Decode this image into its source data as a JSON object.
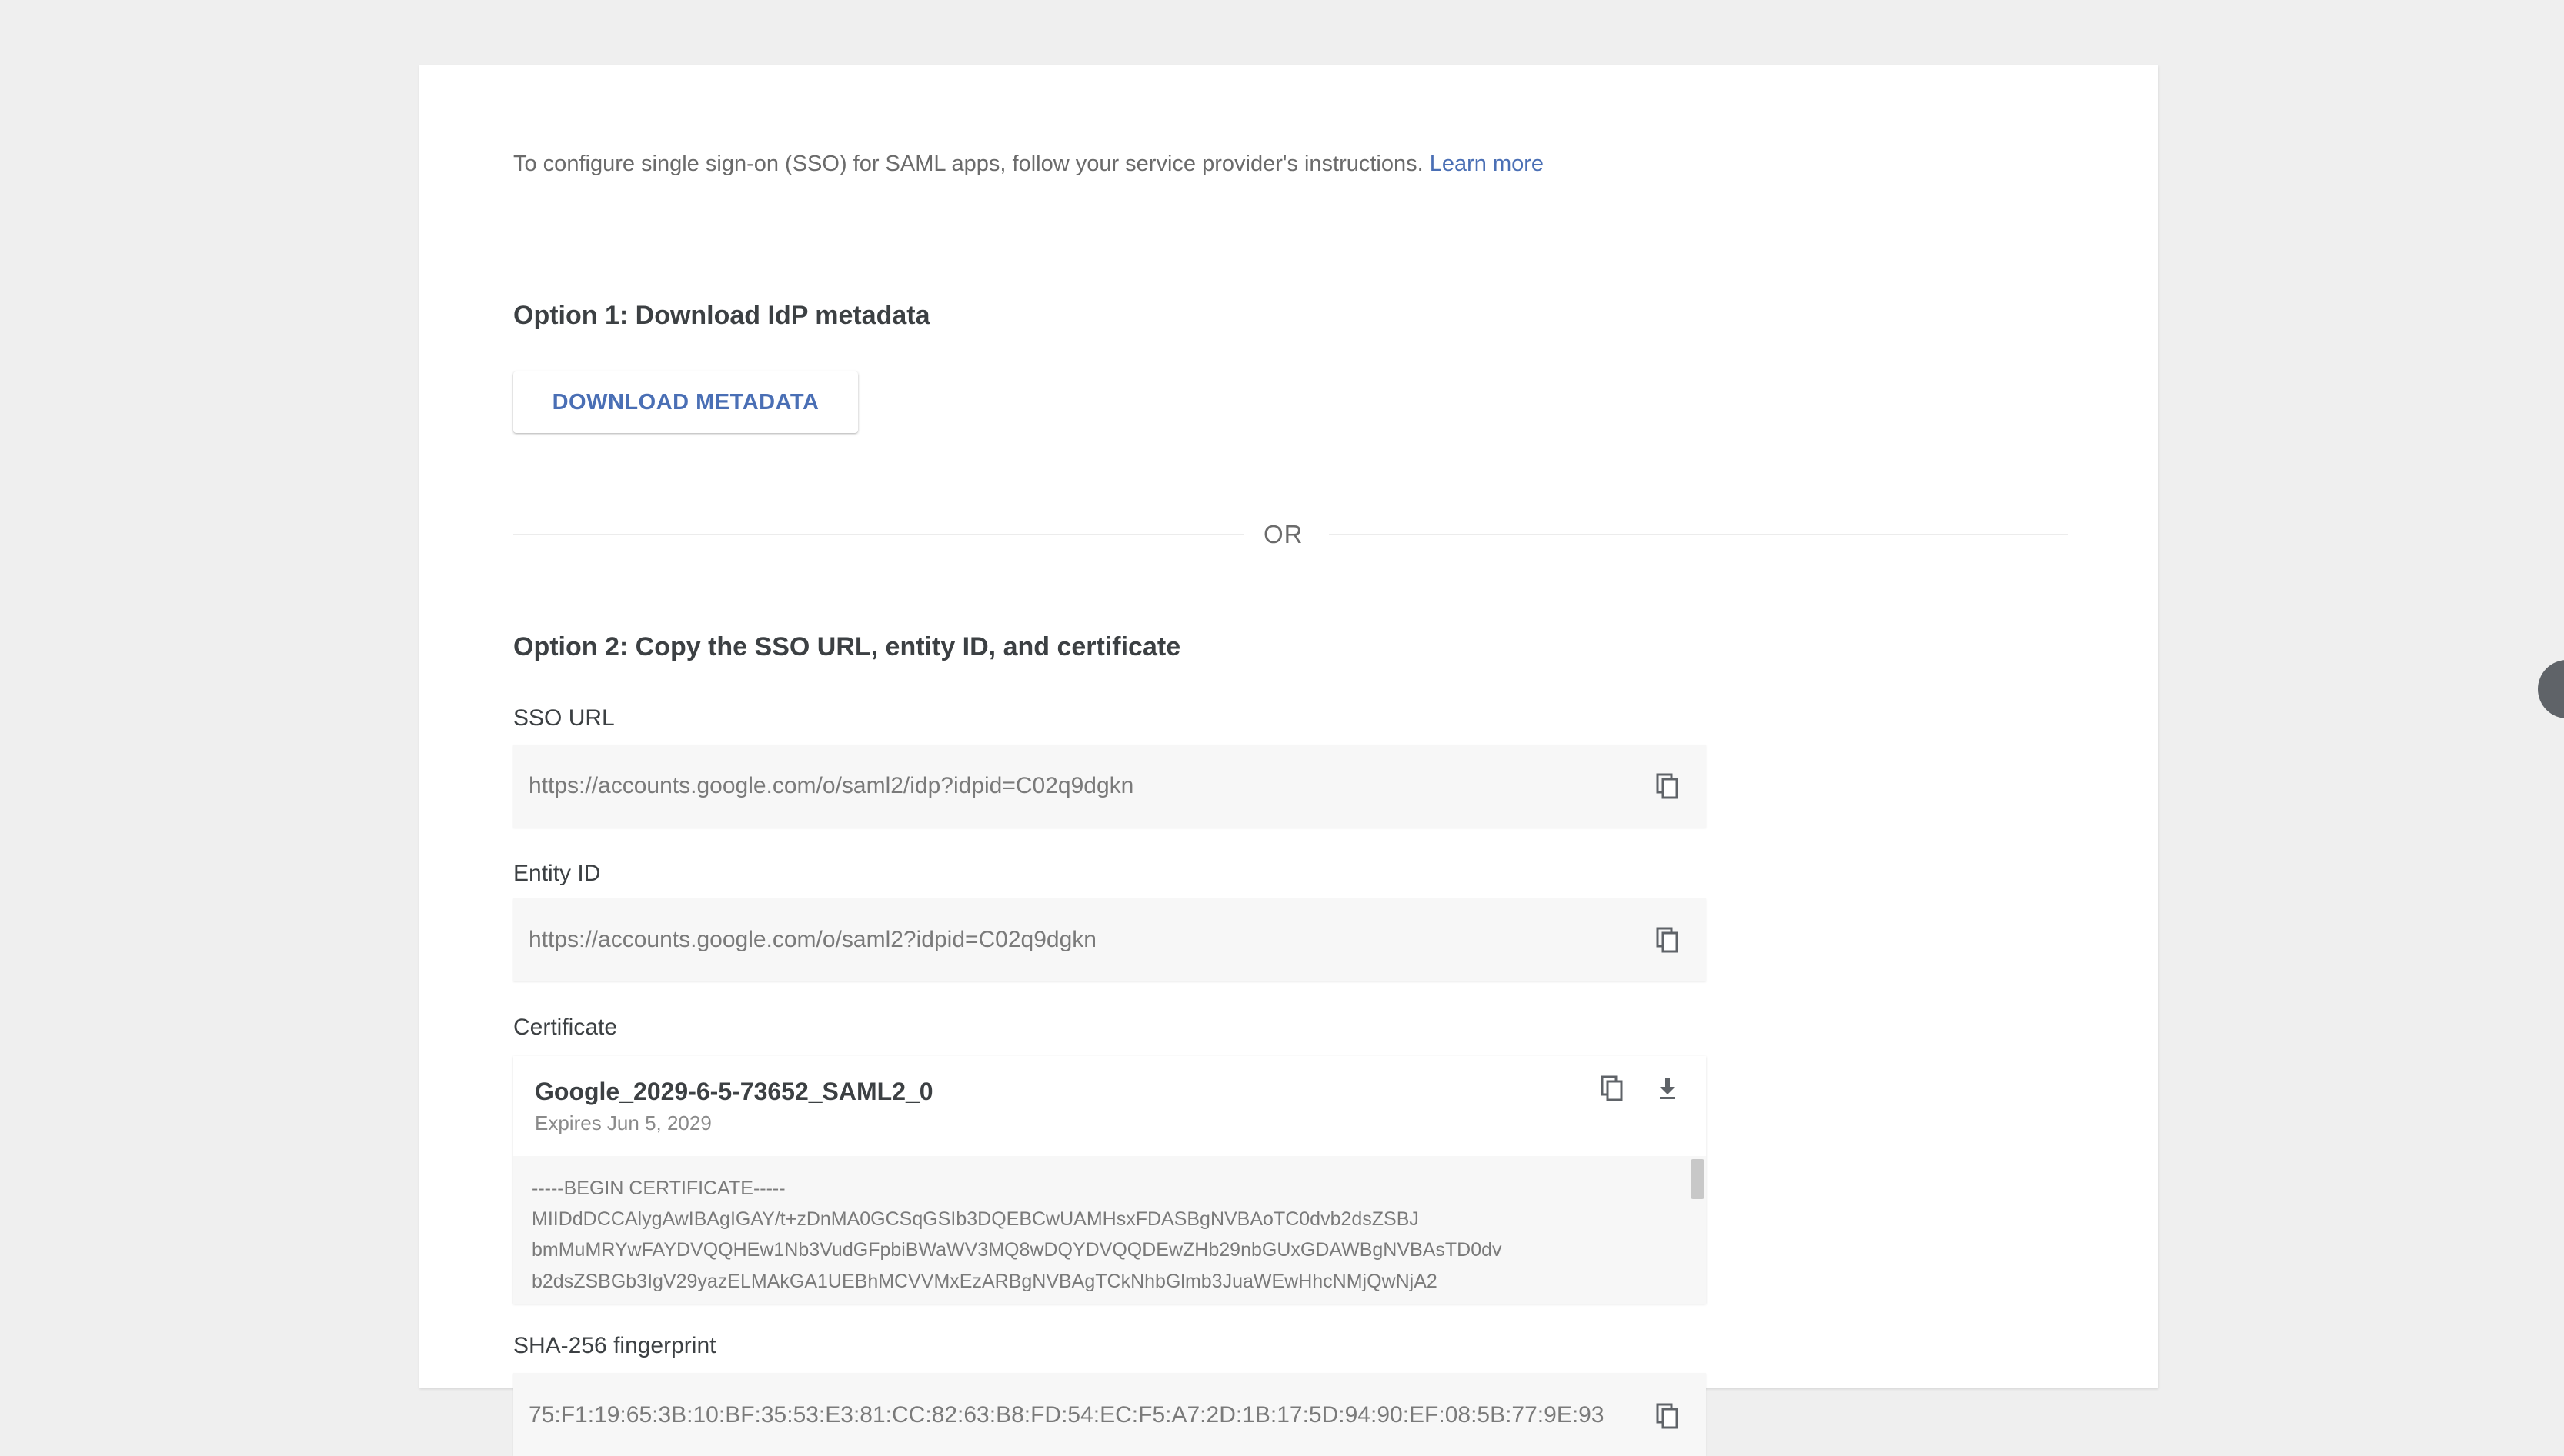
{
  "intro": {
    "text": "To configure single sign-on (SSO) for SAML apps, follow your service provider's instructions.",
    "learn_more": "Learn more"
  },
  "option1": {
    "title": "Option 1: Download IdP metadata",
    "button_label": "DOWNLOAD METADATA"
  },
  "divider": {
    "text": "OR"
  },
  "option2": {
    "title": "Option 2: Copy the SSO URL, entity ID, and certificate",
    "sso_url": {
      "label": "SSO URL",
      "value": "https://accounts.google.com/o/saml2/idp?idpid=C02q9dgkn"
    },
    "entity_id": {
      "label": "Entity ID",
      "value": "https://accounts.google.com/o/saml2?idpid=C02q9dgkn"
    },
    "certificate": {
      "label": "Certificate",
      "name": "Google_2029-6-5-73652_SAML2_0",
      "expiry": "Expires Jun 5, 2029",
      "lines": [
        "-----BEGIN CERTIFICATE-----",
        "MIIDdDCCAlygAwIBAgIGAY/t+zDnMA0GCSqGSIb3DQEBCwUAMHsxFDASBgNVBAoTC0dvb2dsZSBJ",
        "bmMuMRYwFAYDVQQHEw1Nb3VudGFpbiBWaWV3MQ8wDQYDVQQDEwZHb29nbGUxGDAWBgNVBAsTD0dv",
        "b2dsZSBGb3IgV29yazELMAkGA1UEBhMCVVMxEzARBgNVBAgTCkNhbGlmb3JuaWEwHhcNMjQwNjA2"
      ]
    },
    "fingerprint": {
      "label": "SHA-256 fingerprint",
      "value": "75:F1:19:65:3B:10:BF:35:53:E3:81:CC:82:63:B8:FD:54:EC:F5:A7:2D:1B:17:5D:94:90:EF:08:5B:77:9E:93"
    }
  },
  "icons": {
    "copy": "copy-icon",
    "download": "download-icon"
  },
  "colors": {
    "link": "#4a6fb5",
    "background": "#efefef",
    "card": "#ffffff"
  }
}
